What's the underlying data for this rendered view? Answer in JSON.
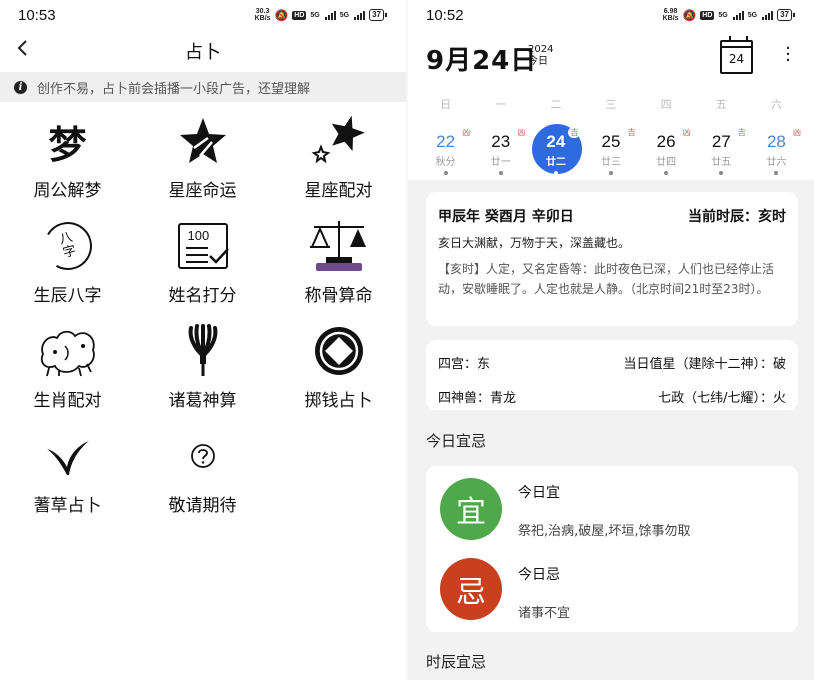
{
  "left": {
    "status": {
      "time": "10:53",
      "speed_top": "30.3",
      "speed_unit": "KB/s",
      "hd": "HD",
      "net1": "5G",
      "net2": "5G",
      "battery": "37"
    },
    "header": {
      "title": "占卜",
      "back_icon": "chevron-left-icon"
    },
    "notice": "创作不易，占卜前会插播一小段广告，还望理解",
    "items": [
      {
        "label": "周公解梦",
        "icon": "dream-icon",
        "glyph": "梦"
      },
      {
        "label": "星座命运",
        "icon": "star-icon"
      },
      {
        "label": "星座配对",
        "icon": "two-stars-icon"
      },
      {
        "label": "生辰八字",
        "icon": "bazi-icon",
        "glyph1": "八",
        "glyph2": "字"
      },
      {
        "label": "姓名打分",
        "icon": "score-icon",
        "score": "100"
      },
      {
        "label": "称骨算命",
        "icon": "scale-icon"
      },
      {
        "label": "生肖配对",
        "icon": "zodiac-animals-icon"
      },
      {
        "label": "诸葛神算",
        "icon": "feather-fan-icon"
      },
      {
        "label": "掷钱占卜",
        "icon": "coin-icon"
      },
      {
        "label": "蓍草占卜",
        "icon": "yarrow-icon"
      },
      {
        "label": "敬请期待",
        "icon": "question-icon"
      }
    ]
  },
  "right": {
    "status": {
      "time": "10:52",
      "speed_top": "6.98",
      "speed_unit": "KB/s",
      "hd": "HD",
      "net1": "5G",
      "net2": "5G",
      "battery": "37"
    },
    "date": "9月24日",
    "year": "2024",
    "today": "今日",
    "cal_icon_day": "24",
    "weekdays": [
      "日",
      "一",
      "二",
      "三",
      "四",
      "五",
      "六"
    ],
    "days": [
      {
        "num": "22",
        "lunar": "秋分",
        "tag": "凶",
        "tag_color": "#d9534f",
        "weekend": true
      },
      {
        "num": "23",
        "lunar": "廿一",
        "tag": "凶",
        "tag_color": "#d9534f",
        "weekend": false
      },
      {
        "num": "24",
        "lunar": "廿二",
        "tag": "吉",
        "tag_color": "#3aa54a",
        "weekend": false,
        "selected": true
      },
      {
        "num": "25",
        "lunar": "廿三",
        "tag": "吉",
        "tag_color": "#3aa54a",
        "weekend": false
      },
      {
        "num": "26",
        "lunar": "廿四",
        "tag": "凶",
        "tag_color": "#d9534f",
        "weekend": false
      },
      {
        "num": "27",
        "lunar": "廿五",
        "tag": "吉",
        "tag_color": "#3aa54a",
        "weekend": false
      },
      {
        "num": "28",
        "lunar": "廿六",
        "tag": "凶",
        "tag_color": "#d9534f",
        "weekend": true
      }
    ],
    "ganzhi": "甲辰年 癸酉月 辛卯日",
    "shichen": "当前时辰：亥时",
    "desc1": "亥日大渊献，万物于天，深盖藏也。",
    "desc2": "【亥时】人定，又名定昏等：此时夜色已深，人们也已经停止活动，安歇睡眠了。人定也就是人静。（北京时间21时至23时）。",
    "info": {
      "gong": "四宫：东",
      "zhixing": "当日值星（建除十二神）：破",
      "shenshou": "四神兽：青龙",
      "qizheng": "七政（七纬/七耀）：火"
    },
    "section1": "今日宜忌",
    "yi": {
      "char": "宜",
      "title": "今日宜",
      "content": "祭祀,治病,破屋,坏垣,馀事勿取",
      "color": "#4fa84a"
    },
    "ji": {
      "char": "忌",
      "title": "今日忌",
      "content": "诸事不宜",
      "color": "#c8401e"
    },
    "section2": "时辰宜忌"
  }
}
